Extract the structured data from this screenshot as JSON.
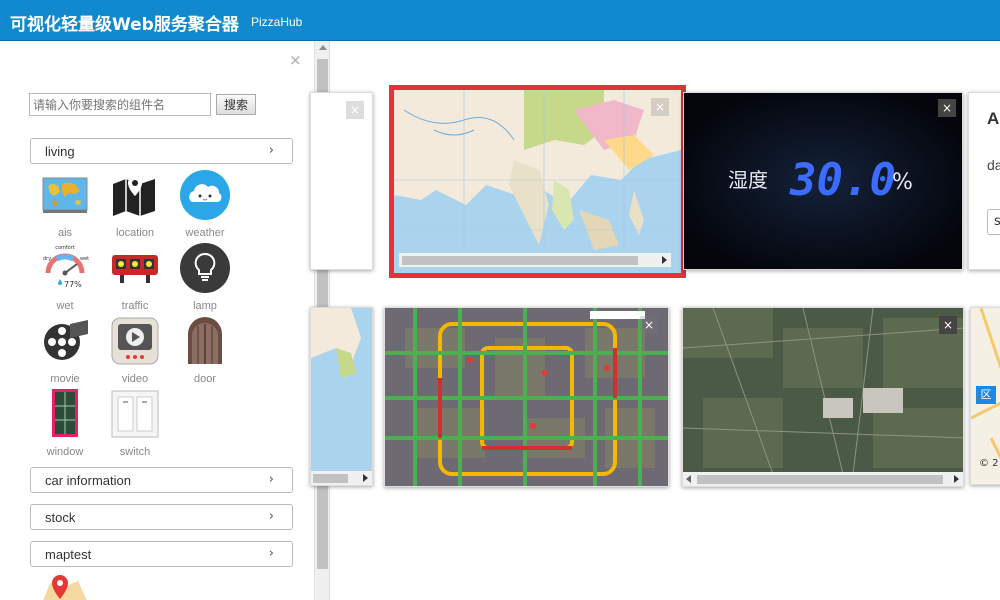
{
  "header": {
    "title": "可视化轻量级Web服务聚合器",
    "subtitle": "PizzaHub"
  },
  "sidebar": {
    "close_glyph": "×",
    "search_placeholder": "请输入你要搜索的组件名",
    "search_button": "搜索",
    "categories": [
      {
        "label": "living"
      },
      {
        "label": "car information"
      },
      {
        "label": "stock"
      },
      {
        "label": "maptest"
      }
    ],
    "chevron": "›",
    "widgets": [
      {
        "label": "ais",
        "icon": "world-map-icon"
      },
      {
        "label": "location",
        "icon": "location-map-icon"
      },
      {
        "label": "weather",
        "icon": "cloud-icon"
      },
      {
        "label": "wet",
        "icon": "gauge-icon",
        "gauge_top": "comfort",
        "gauge_left": "dry",
        "gauge_right": "wet",
        "gauge_value": "77%"
      },
      {
        "label": "traffic",
        "icon": "traffic-light-icon"
      },
      {
        "label": "lamp",
        "icon": "lightbulb-icon"
      },
      {
        "label": "movie",
        "icon": "film-reel-icon"
      },
      {
        "label": "video",
        "icon": "play-button-icon"
      },
      {
        "label": "door",
        "icon": "door-icon"
      },
      {
        "label": "window",
        "icon": "window-icon"
      },
      {
        "label": "switch",
        "icon": "light-switch-icon"
      }
    ]
  },
  "main": {
    "close_glyph": "×",
    "humidity_label": "湿度",
    "humidity_value": "30.0",
    "humidity_unit": "%",
    "partial_card": {
      "title_fragment": "A",
      "text_fragment": "da",
      "button_fragment": "s"
    },
    "map_badge": "区",
    "map_credit": "© 2"
  },
  "colors": {
    "header_bg": "#1189ce",
    "selection_border": "#e8303a",
    "humidity_digits": "#2a5cff"
  }
}
